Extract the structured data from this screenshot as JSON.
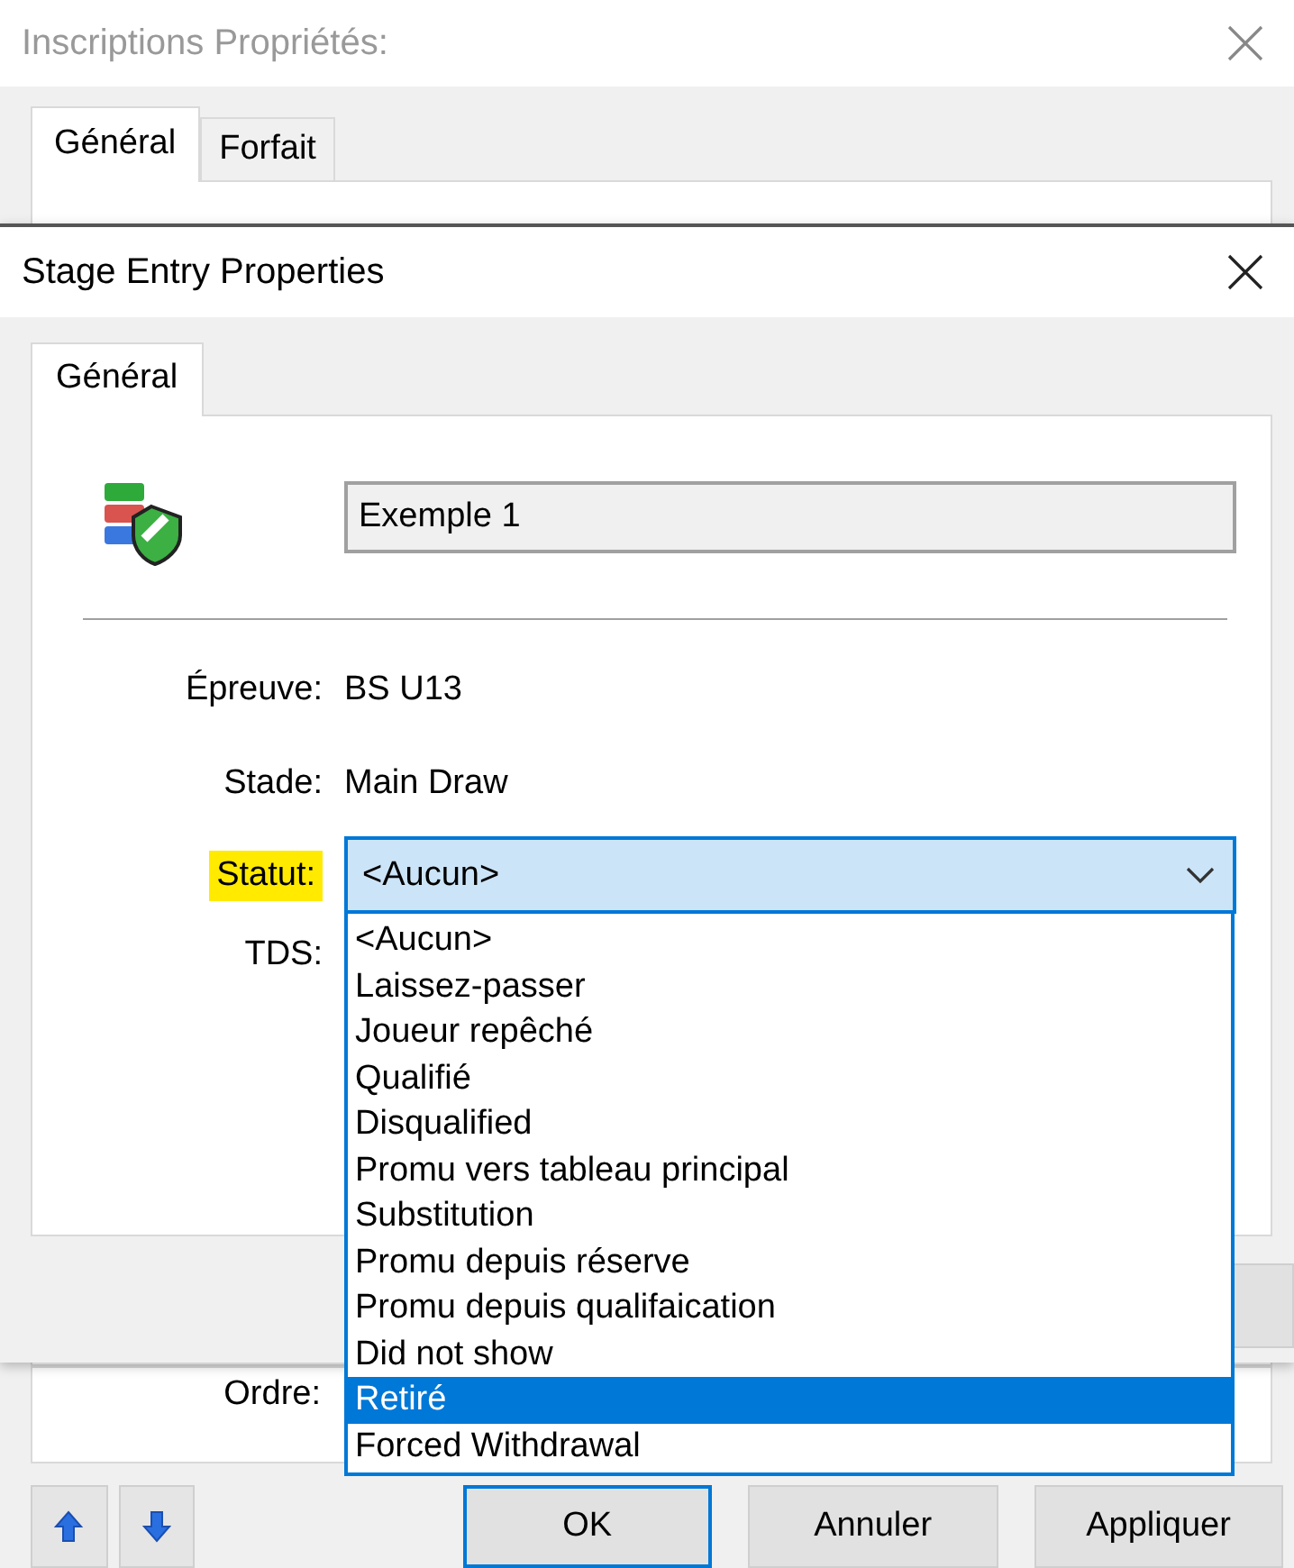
{
  "background_window": {
    "title": "Inscriptions Propriétés:",
    "tabs": [
      {
        "label": "Général",
        "selected": true
      },
      {
        "label": "Forfait",
        "selected": false
      }
    ],
    "order_label": "Ordre:",
    "buttons": [
      {
        "label": "OK",
        "default": true
      },
      {
        "label": "Annuler",
        "default": false
      },
      {
        "label": "Appliquer",
        "default": false
      }
    ]
  },
  "front_window": {
    "title": "Stage Entry Properties",
    "tabs": [
      {
        "label": "Général",
        "selected": true
      }
    ],
    "name_field": {
      "value": "Exemple 1"
    },
    "info_rows": [
      {
        "label": "Épreuve:",
        "value": "BS U13"
      },
      {
        "label": "Stade:",
        "value": "Main Draw"
      }
    ],
    "status": {
      "label": "Statut:",
      "highlighted": true,
      "value": "<Aucun>",
      "expanded": true,
      "options": [
        {
          "label": "<Aucun>",
          "highlighted": false
        },
        {
          "label": "Laissez-passer",
          "highlighted": false
        },
        {
          "label": "Joueur repêché",
          "highlighted": false
        },
        {
          "label": "Qualifié",
          "highlighted": false
        },
        {
          "label": "Disqualified",
          "highlighted": false
        },
        {
          "label": "Promu vers tableau principal",
          "highlighted": false
        },
        {
          "label": "Substitution",
          "highlighted": false
        },
        {
          "label": "Promu depuis réserve",
          "highlighted": false
        },
        {
          "label": "Promu depuis qualifaication",
          "highlighted": false
        },
        {
          "label": "Did not show",
          "highlighted": false
        },
        {
          "label": "Retiré",
          "highlighted": true
        },
        {
          "label": "Forced Withdrawal",
          "highlighted": false
        }
      ]
    },
    "seed_label": "TDS:"
  }
}
